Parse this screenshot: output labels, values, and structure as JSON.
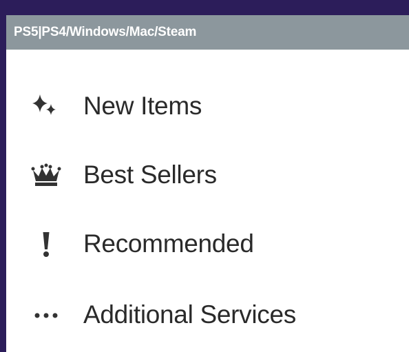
{
  "header": {
    "platforms": "PS5|PS4/Windows/Mac/Steam"
  },
  "menu": {
    "items": [
      {
        "label": "New Items",
        "icon": "sparkles-icon"
      },
      {
        "label": "Best Sellers",
        "icon": "crown-icon"
      },
      {
        "label": "Recommended",
        "icon": "exclamation-icon"
      },
      {
        "label": "Additional Services",
        "icon": "more-dots-icon"
      }
    ]
  },
  "colors": {
    "background": "#2c1d5a",
    "header_bar": "#8c979d",
    "panel": "#ffffff",
    "text": "#2a2a2a",
    "icon": "#333333"
  }
}
